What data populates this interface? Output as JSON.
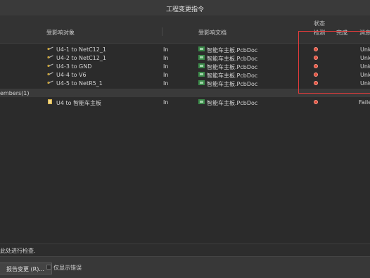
{
  "window": {
    "title": "工程变更指令"
  },
  "header": {
    "col_object": "受影响对象",
    "col_document": "受影响文档",
    "status_group": "状态",
    "col_check": "检测",
    "col_done": "完成",
    "col_message": "消息"
  },
  "rows": [
    {
      "object": "U4-1 to NetC12_1",
      "dir": "In",
      "doc": "智能车主板.PcbDoc",
      "message": "Unk"
    },
    {
      "object": "U4-2 to NetC12_1",
      "dir": "In",
      "doc": "智能车主板.PcbDoc",
      "message": "Unk"
    },
    {
      "object": "U4-3 to GND",
      "dir": "In",
      "doc": "智能车主板.PcbDoc",
      "message": "Unk"
    },
    {
      "object": "U4-4 to V6",
      "dir": "In",
      "doc": "智能车主板.PcbDoc",
      "message": "Unk"
    },
    {
      "object": "U4-5 to NetR5_1",
      "dir": "In",
      "doc": "智能车主板.PcbDoc",
      "message": "Unk"
    }
  ],
  "group": {
    "label": "embers(1)"
  },
  "group_rows": [
    {
      "object": "U4 to 智能车主板",
      "dir": "In",
      "doc": "智能车主板.PcbDoc",
      "message": "Faile"
    }
  ],
  "status_text": "此处进行检查.",
  "footer": {
    "report_button": "报告变更 (R)...",
    "only_errors_label": "仅显示错误"
  },
  "colors": {
    "error": "#e0503f",
    "highlight": "#e23b3b",
    "icon_green": "#3c8a4a",
    "icon_gold": "#c8a23a"
  }
}
